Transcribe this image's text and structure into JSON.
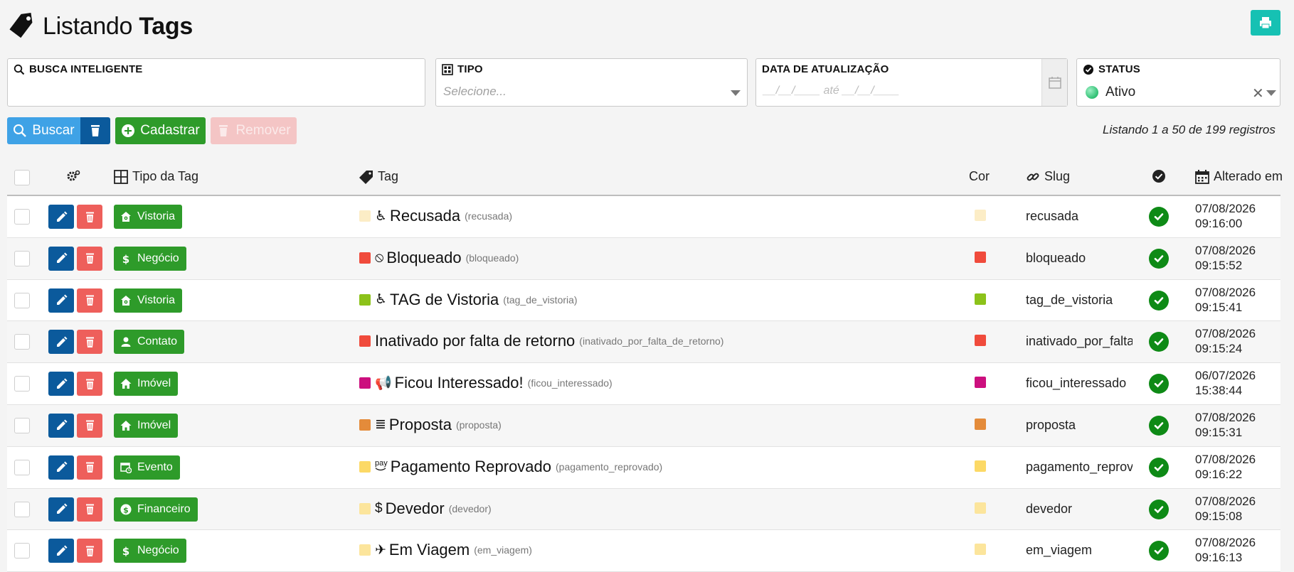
{
  "header": {
    "title_prefix": "Listando",
    "title_bold": "Tags"
  },
  "filters": {
    "search": {
      "label": "BUSCA INTELIGENTE"
    },
    "tipo": {
      "label": "TIPO",
      "placeholder": "Selecione..."
    },
    "data": {
      "label": "DATA DE ATUALIZAÇÃO",
      "placeholder": "__/__/____  até  __/__/____"
    },
    "status": {
      "label": "STATUS",
      "value": "Ativo"
    }
  },
  "actions": {
    "buscar": "Buscar",
    "cadastrar": "Cadastrar",
    "remover": "Remover"
  },
  "records_info": "Listando 1 a 50 de 199 registros",
  "table": {
    "headers": {
      "tipo": "Tipo da Tag",
      "tag": "Tag",
      "cor": "Cor",
      "slug": "Slug",
      "alterado": "Alterado em"
    },
    "rows": [
      {
        "tipo": "Vistoria",
        "tipo_icon": "house-gear-icon",
        "color": "#fcedc6",
        "glyph": "♿",
        "tag": "Recusada",
        "slug_small": "(recusada)",
        "slug": "recusada",
        "date": "07/08/2026",
        "time": "09:16:00"
      },
      {
        "tipo": "Negócio",
        "tipo_icon": "dollar-icon",
        "color": "#f04b3c",
        "glyph": "⦸",
        "tag": "Bloqueado",
        "slug_small": "(bloqueado)",
        "slug": "bloqueado",
        "date": "07/08/2026",
        "time": "09:15:52"
      },
      {
        "tipo": "Vistoria",
        "tipo_icon": "house-gear-icon",
        "color": "#8cc21a",
        "glyph": "♿",
        "tag": "TAG de Vistoria",
        "slug_small": "(tag_de_vistoria)",
        "slug": "tag_de_vistoria",
        "date": "07/08/2026",
        "time": "09:15:41"
      },
      {
        "tipo": "Contato",
        "tipo_icon": "user-icon",
        "color": "#f04b3c",
        "glyph": "",
        "tag": "Inativado por falta de retorno",
        "slug_small": "(inativado_por_falta_de_retorno)",
        "slug": "inativado_por_falta_de_retorno",
        "date": "07/08/2026",
        "time": "09:15:24"
      },
      {
        "tipo": "Imóvel",
        "tipo_icon": "home-icon",
        "color": "#cc0f7e",
        "glyph": "📢",
        "tag": "Ficou Interessado!",
        "slug_small": "(ficou_interessado)",
        "slug": "ficou_interessado",
        "date": "06/07/2026",
        "time": "15:38:44"
      },
      {
        "tipo": "Imóvel",
        "tipo_icon": "home-icon",
        "color": "#e48b3a",
        "glyph": "≣",
        "tag": "Proposta",
        "slug_small": "(proposta)",
        "slug": "proposta",
        "date": "07/08/2026",
        "time": "09:15:31"
      },
      {
        "tipo": "Evento",
        "tipo_icon": "calendar-clock-icon",
        "color": "#fcd966",
        "glyph": "pay",
        "tag": "Pagamento Reprovado",
        "slug_small": "(pagamento_reprovado)",
        "slug": "pagamento_reprovado",
        "date": "07/08/2026",
        "time": "09:16:22"
      },
      {
        "tipo": "Financeiro",
        "tipo_icon": "money-circle-icon",
        "color": "#fce59c",
        "glyph": "$",
        "tag": "Devedor",
        "slug_small": "(devedor)",
        "slug": "devedor",
        "date": "07/08/2026",
        "time": "09:15:08"
      },
      {
        "tipo": "Negócio",
        "tipo_icon": "dollar-icon",
        "color": "#fce59c",
        "glyph": "✈",
        "tag": "Em Viagem",
        "slug_small": "(em_viagem)",
        "slug": "em_viagem",
        "date": "07/08/2026",
        "time": "09:16:13"
      }
    ]
  }
}
